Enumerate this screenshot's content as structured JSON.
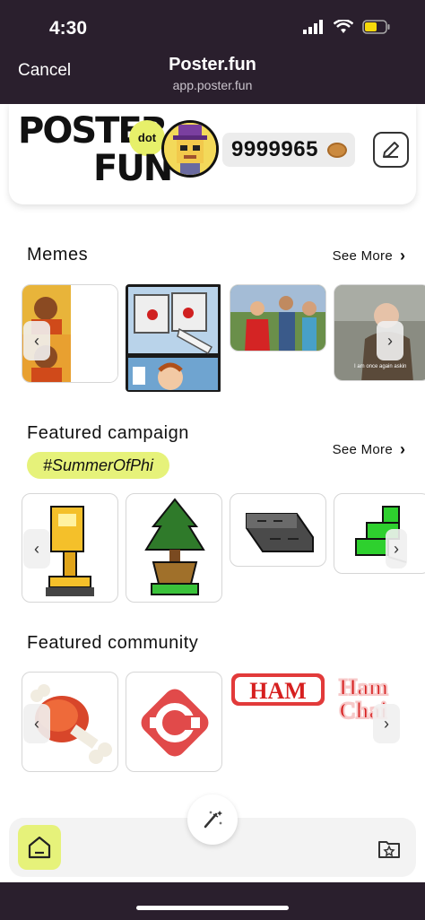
{
  "status_bar": {
    "time": "4:30"
  },
  "nav": {
    "cancel": "Cancel",
    "title": "Poster.fun",
    "url": "app.poster.fun"
  },
  "header": {
    "logo_word_1": "POSTER",
    "logo_word_2": "FUN",
    "logo_dot": "dot",
    "balance": "9999965"
  },
  "sections": {
    "memes": {
      "title": "Memes",
      "see_more": "See More"
    },
    "campaign": {
      "title": "Featured campaign",
      "see_more": "See More",
      "hashtag": "#SummerOfPhi"
    },
    "community": {
      "title": "Featured community"
    }
  },
  "meme_cards": [
    {
      "name": "drake"
    },
    {
      "name": "two-buttons"
    },
    {
      "name": "distracted-boyfriend"
    },
    {
      "name": "bernie",
      "caption": "I am once again askin"
    }
  ],
  "campaign_cards": [
    {
      "name": "trophy"
    },
    {
      "name": "potted-tree"
    },
    {
      "name": "stone-wall"
    },
    {
      "name": "green-blocks"
    }
  ],
  "community_cards": [
    {
      "name": "meat-drumstick"
    },
    {
      "name": "red-diamond-c"
    },
    {
      "name": "ham-text",
      "text": "HAM"
    },
    {
      "name": "ham-chain-text",
      "text": "Ham Chai"
    }
  ],
  "colors": {
    "accent": "#e6f27a",
    "dark": "#2a1f2d"
  }
}
